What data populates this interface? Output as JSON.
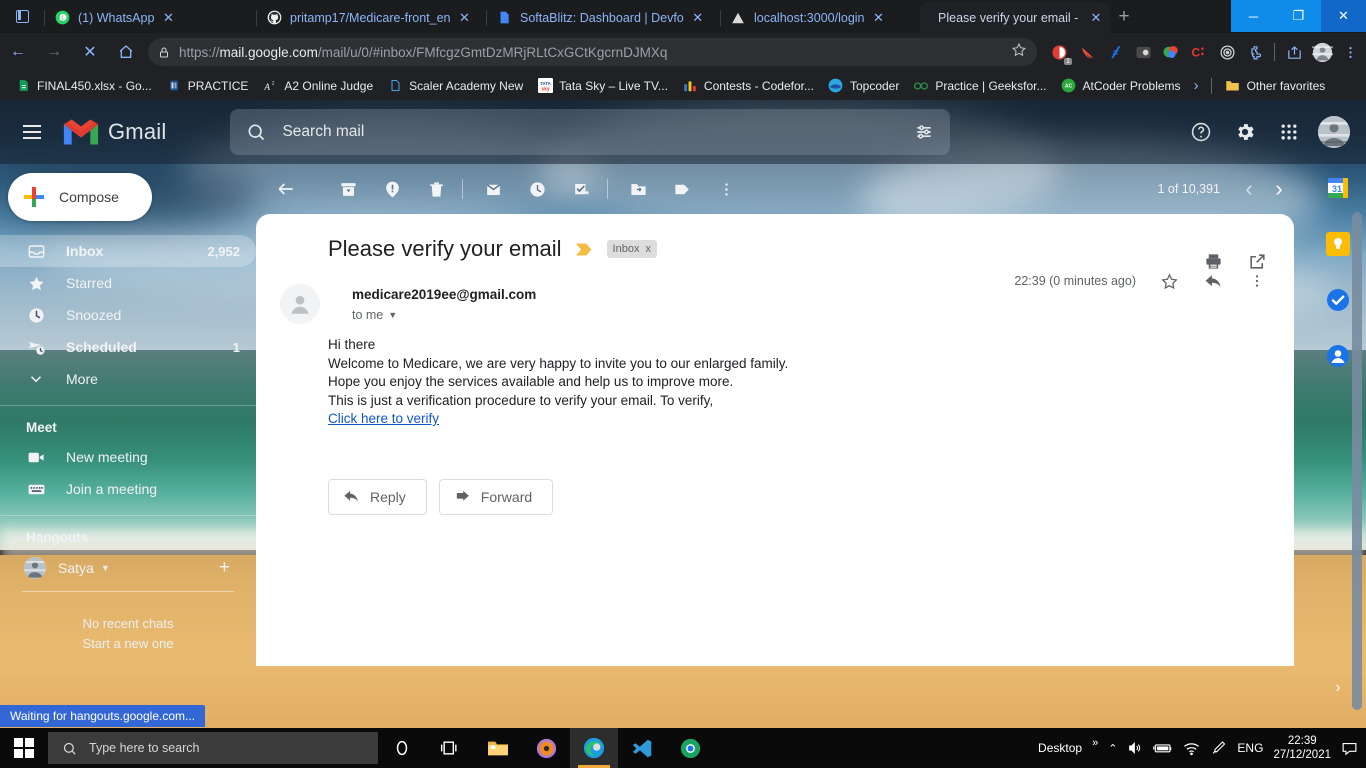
{
  "browser": {
    "tabs": [
      {
        "label": "(1) WhatsApp",
        "icon": "whatsapp-icon",
        "active": false
      },
      {
        "label": "pritamp17/Medicare-front_en",
        "icon": "github-icon",
        "active": false
      },
      {
        "label": "SoftaBlitz: Dashboard | Devfo",
        "icon": "page-icon",
        "active": false
      },
      {
        "label": "localhost:3000/login",
        "icon": "triangle-icon",
        "active": false
      },
      {
        "label": "Please verify your email - satt",
        "icon": "none",
        "active": true
      }
    ],
    "new_tab_label": "+",
    "window_controls": {
      "minimize": "─",
      "maximize": "❐",
      "close": "✕"
    },
    "nav": {
      "back": "←",
      "forward": "→",
      "stop": "✕",
      "home": "⌂"
    },
    "url_prefix": "https://",
    "url_domain": "mail.google.com",
    "url_path": "/mail/u/0/#inbox/FMfcgzGmtDzMRjRLtCxGCtKgcrnDJMXq",
    "extension_badge": "1",
    "bookmarks": [
      {
        "label": "FINAL450.xlsx - Go...",
        "icon": "sheets-icon"
      },
      {
        "label": "PRACTICE",
        "icon": "doc-icon"
      },
      {
        "label": "A2 Online Judge",
        "icon": "a2-icon"
      },
      {
        "label": "Scaler Academy New",
        "icon": "page-icon"
      },
      {
        "label": "Tata Sky – Live TV...",
        "icon": "tatasky-icon"
      },
      {
        "label": "Contests - Codefor...",
        "icon": "codeforces-icon"
      },
      {
        "label": "Topcoder",
        "icon": "topcoder-icon"
      },
      {
        "label": "Practice | Geeksfor...",
        "icon": "gfg-icon"
      },
      {
        "label": "AtCoder Problems",
        "icon": "atcoder-icon"
      }
    ],
    "bookmarks_overflow": "›",
    "other_favorites": "Other favorites"
  },
  "gmail": {
    "app_name": "Gmail",
    "search": {
      "placeholder": "Search mail",
      "icon": "search-icon",
      "options_icon": "tune-icon"
    },
    "header_icons": [
      "help-icon",
      "gear-icon",
      "apps-grid-icon",
      "avatar"
    ],
    "compose_label": "Compose",
    "nav_items": [
      {
        "label": "Inbox",
        "count": "2,952",
        "icon": "inbox-icon",
        "selected": true
      },
      {
        "label": "Starred",
        "count": "",
        "icon": "star-icon",
        "selected": false
      },
      {
        "label": "Snoozed",
        "count": "",
        "icon": "clock-icon",
        "selected": false
      },
      {
        "label": "Scheduled",
        "count": "1",
        "icon": "scheduled-icon",
        "selected": false
      },
      {
        "label": "More",
        "count": "",
        "icon": "chevron-down-icon",
        "selected": false
      }
    ],
    "meet": {
      "title": "Meet",
      "items": [
        {
          "label": "New meeting",
          "icon": "video-camera-icon"
        },
        {
          "label": "Join a meeting",
          "icon": "keyboard-icon"
        }
      ]
    },
    "hangouts": {
      "title": "Hangouts",
      "user": "Satya",
      "add_label": "+",
      "empty_line1": "No recent chats",
      "empty_line2": "Start a new one"
    },
    "toolbar_icons": [
      "back-icon",
      "archive-icon",
      "report-spam-icon",
      "delete-icon",
      "mark-unread-icon",
      "snooze-icon",
      "add-to-tasks-icon",
      "move-to-icon",
      "labels-icon",
      "more-icon"
    ],
    "pager": {
      "text": "1 of 10,391",
      "prev": "‹",
      "next": "›"
    },
    "right_panel_icons": [
      "calendar-icon",
      "keep-icon",
      "tasks-icon",
      "contacts-icon"
    ],
    "right_panel_expand": "›"
  },
  "email": {
    "subject": "Please verify your email",
    "important_marker": "important-marker-icon",
    "label_chip": "Inbox",
    "label_chip_remove": "x",
    "print_icon": "print-icon",
    "popout_icon": "open-in-new-icon",
    "sender": "medicare2019ee@gmail.com",
    "recipient": "to me",
    "timestamp": "22:39 (0 minutes ago)",
    "star_icon": "star-outline-icon",
    "reply_arrow_icon": "reply-icon",
    "more_icon": "more-vert-icon",
    "body_lines": [
      "Hi there",
      "Welcome to Medicare, we are very happy to invite you to our enlarged family.",
      "Hope you enjoy the services available and help us to improve more.",
      "This is just a verification procedure to verify your email. To verify,"
    ],
    "body_link": "Click here to verify",
    "reply_button": "Reply",
    "forward_button": "Forward"
  },
  "status_bar": {
    "text": "Waiting for hangouts.google.com..."
  },
  "taskbar": {
    "start_icon": "windows-logo-icon",
    "search_placeholder": "Type here to search",
    "buttons": [
      "cortana-icon",
      "task-view-icon",
      "file-explorer-icon",
      "media-player-icon",
      "edge-icon",
      "vscode-icon",
      "chrome-icon"
    ],
    "tray": {
      "desktop_label": "Desktop",
      "overflow": "»",
      "chevron": "⌃",
      "icons": [
        "volume-icon",
        "battery-icon",
        "wifi-icon",
        "pen-icon"
      ],
      "language": "ENG",
      "time": "22:39",
      "date": "27/12/2021",
      "notification_icon": "notification-icon"
    }
  }
}
